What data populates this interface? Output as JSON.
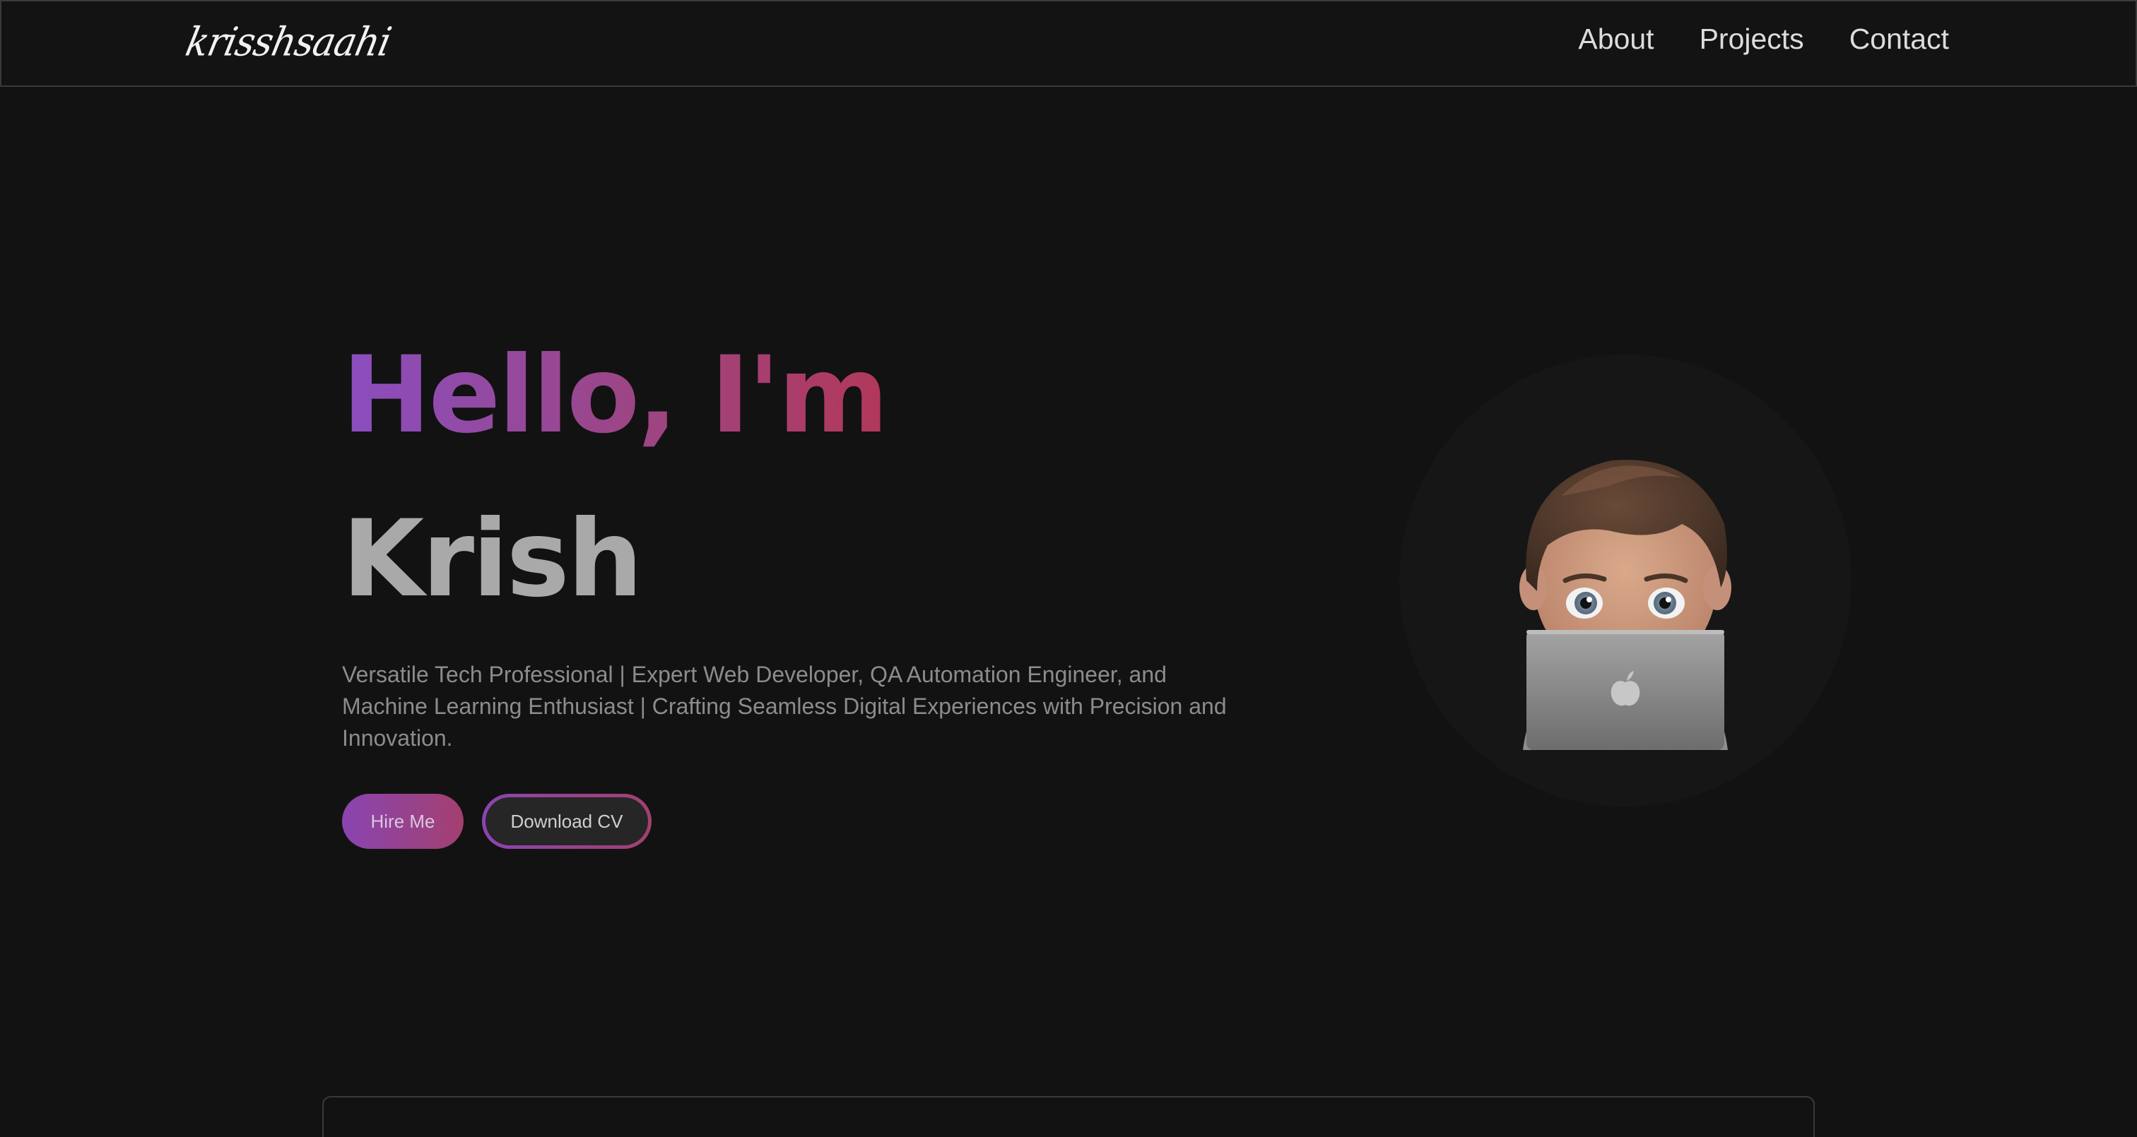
{
  "nav": {
    "logo": "krisshsaahi",
    "links": [
      "About",
      "Projects",
      "Contact"
    ]
  },
  "hero": {
    "greeting": "Hello, I'm",
    "name": "Krish",
    "description": "Versatile Tech Professional | Expert Web Developer, QA Automation Engineer, and Machine Learning Enthusiast | Crafting Seamless Digital Experiences with Precision and Innovation.",
    "buttons": {
      "hire": "Hire Me",
      "cv": "Download CV"
    }
  },
  "colors": {
    "background": "#121212",
    "accent_start": "#8a44b0",
    "accent_end": "#a3406f",
    "name_gray": "#a9a9a9"
  },
  "icons": {
    "avatar": "memoji-laptop-avatar"
  }
}
